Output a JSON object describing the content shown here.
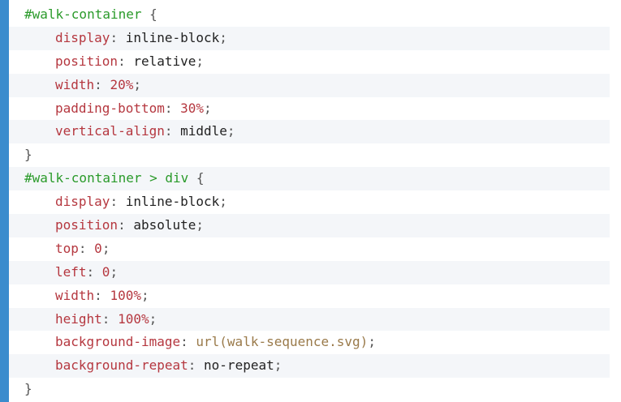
{
  "lines": [
    {
      "t": "sel",
      "sel": "#walk-container",
      "open": " {"
    },
    {
      "t": "decl",
      "prop": "display",
      "value": "inline-block",
      "vtype": "kw"
    },
    {
      "t": "decl",
      "prop": "position",
      "value": "relative",
      "vtype": "kw"
    },
    {
      "t": "decl",
      "prop": "width",
      "value": "20%",
      "vtype": "num"
    },
    {
      "t": "decl",
      "prop": "padding-bottom",
      "value": "30%",
      "vtype": "num"
    },
    {
      "t": "decl",
      "prop": "vertical-align",
      "value": "middle",
      "vtype": "kw"
    },
    {
      "t": "close",
      "text": "}"
    },
    {
      "t": "sel",
      "sel": "#walk-container > div",
      "open": " {"
    },
    {
      "t": "decl",
      "prop": "display",
      "value": "inline-block",
      "vtype": "kw"
    },
    {
      "t": "decl",
      "prop": "position",
      "value": "absolute",
      "vtype": "kw"
    },
    {
      "t": "decl",
      "prop": "top",
      "value": "0",
      "vtype": "num"
    },
    {
      "t": "decl",
      "prop": "left",
      "value": "0",
      "vtype": "num"
    },
    {
      "t": "decl",
      "prop": "width",
      "value": "100%",
      "vtype": "num"
    },
    {
      "t": "decl",
      "prop": "height",
      "value": "100%",
      "vtype": "num"
    },
    {
      "t": "decl",
      "prop": "background-image",
      "value": "url(walk-sequence.svg)",
      "vtype": "str"
    },
    {
      "t": "decl",
      "prop": "background-repeat",
      "value": "no-repeat",
      "vtype": "kw"
    },
    {
      "t": "close",
      "text": "}"
    }
  ],
  "colors": {
    "accent_bar": "#3b8ccd",
    "selector": "#2a9a2a",
    "property": "#b5373f",
    "string": "#9a7a4a",
    "stripe": "#f4f6f9"
  }
}
